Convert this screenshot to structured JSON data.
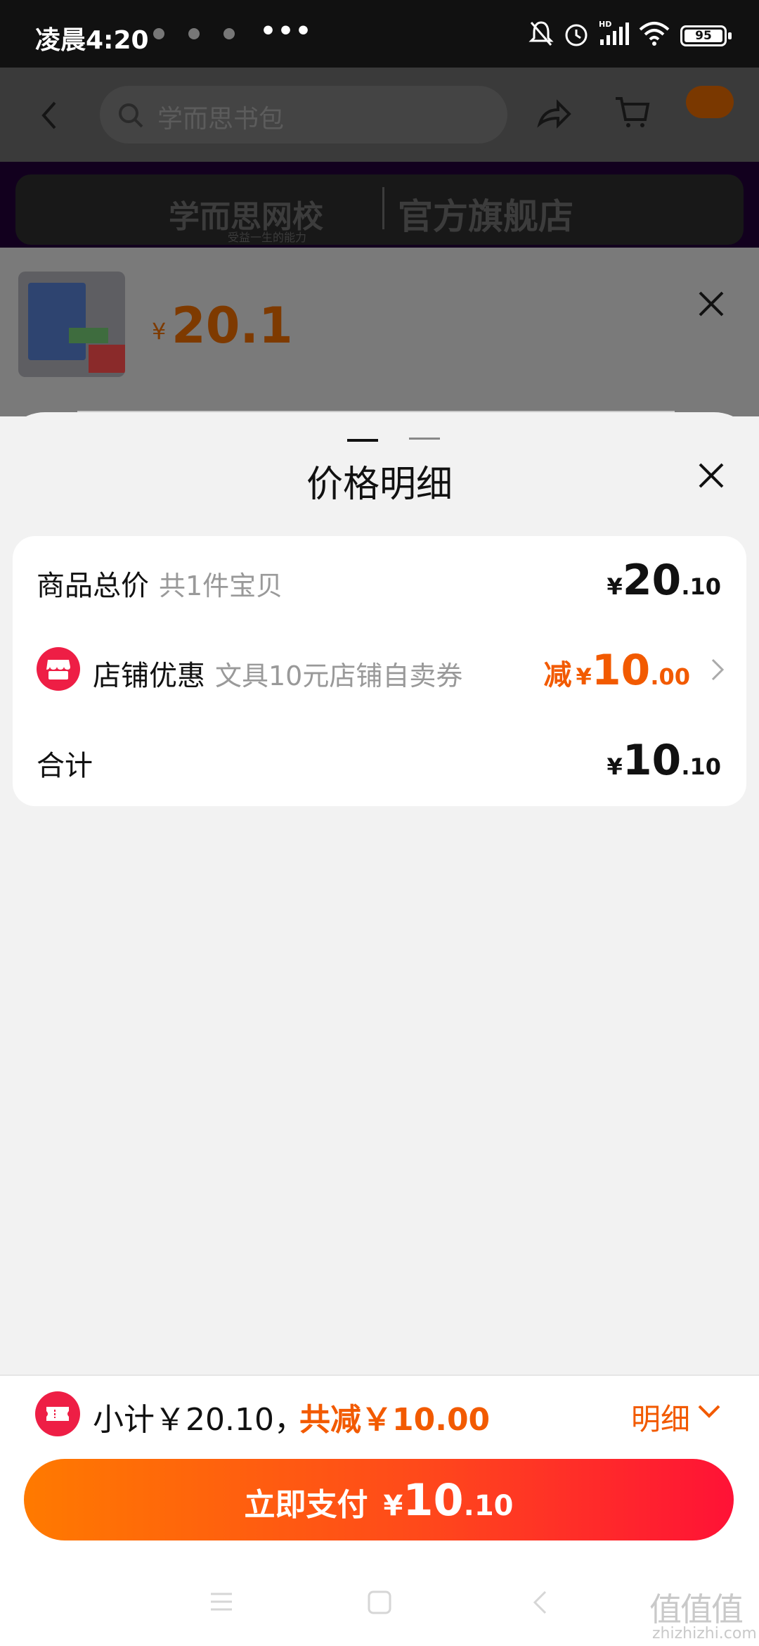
{
  "status_bar": {
    "time": "凌晨4:20",
    "overflow": "•••",
    "battery": "95"
  },
  "background_page": {
    "search_placeholder": "学而思书包",
    "store_banner": {
      "logo_text": "学而思网校",
      "logo_slogan": "受益一生的能力",
      "flagship": "官方旗舰店"
    },
    "product": {
      "currency": "¥",
      "price": "20.1"
    }
  },
  "sheet": {
    "title": "价格明细",
    "rows": [
      {
        "label": "商品总价",
        "hint": "共1件宝贝",
        "currency": "¥",
        "amount_int": "20",
        "amount_dec": ".10"
      },
      {
        "label": "店铺优惠",
        "hint": "文具10元店铺自卖券",
        "prefix": "减",
        "currency": "¥",
        "amount_int": "10",
        "amount_dec": ".00"
      },
      {
        "label": "合计",
        "currency": "¥",
        "amount_int": "10",
        "amount_dec": ".10"
      }
    ]
  },
  "bottom_bar": {
    "subtotal_text": "小计￥20.10，",
    "saving_text": "共减￥10.00",
    "detail_label": "明细",
    "pay_button": {
      "label": "立即支付",
      "currency": "¥",
      "amount_int": "10",
      "amount_dec": ".10"
    }
  },
  "watermark": {
    "text": "值值值",
    "domain": "zhizhizhi.com"
  },
  "colors": {
    "accent_orange": "#f25a00",
    "badge_red": "#ee1e45",
    "pay_gradient_start": "#ff7a00",
    "pay_gradient_end": "#ff1236"
  },
  "icons": [
    "back-icon",
    "search-icon",
    "share-icon",
    "cart-icon",
    "close-icon",
    "store-icon",
    "coupon-icon",
    "chevron-right-icon",
    "chevron-down-icon",
    "menu-nav-icon",
    "home-nav-icon",
    "back-nav-icon"
  ]
}
